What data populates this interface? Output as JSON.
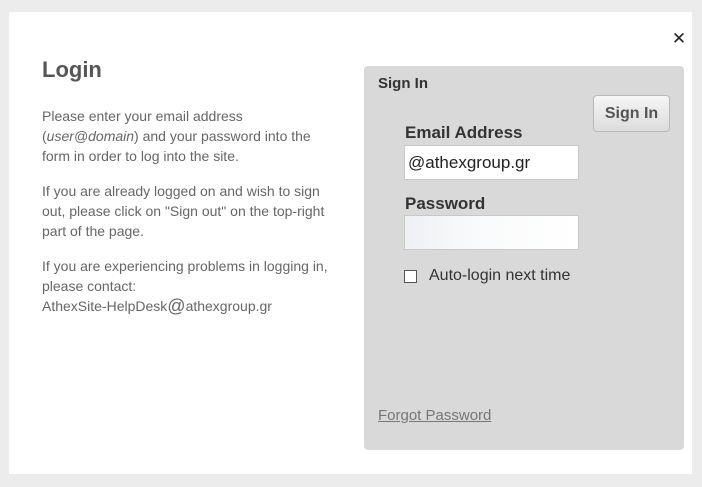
{
  "dialog": {
    "close_symbol": "✕",
    "close_icon": "close-icon"
  },
  "info": {
    "title": "Login",
    "para1_before": "Please enter your email address (",
    "para1_italic": "user@domain",
    "para1_after": ") and your password into the form in order to log into the site.",
    "para2": "If you are already logged on and wish to sign out, please click on \"Sign out\" on the top-right part of the page.",
    "para3_text": "If you are experiencing problems in logging in, please contact:",
    "para3_contact_user": "AthexSite-HelpDesk",
    "para3_contact_at": "@",
    "para3_contact_domain": "athexgroup.gr"
  },
  "form": {
    "panel_title": "Sign In",
    "signin_button": "Sign In",
    "email_label": "Email Address",
    "email_value": "@athexgroup.gr",
    "password_label": "Password",
    "password_value": "",
    "autologin_label": "Auto-login next time",
    "autologin_checked": false,
    "forgot_link": "Forgot Password"
  },
  "colors": {
    "page_background": "#ececec",
    "dialog_background": "#ffffff",
    "panel_background": "#d9d9d9",
    "body_text": "#666666",
    "heading_text": "#555555"
  }
}
